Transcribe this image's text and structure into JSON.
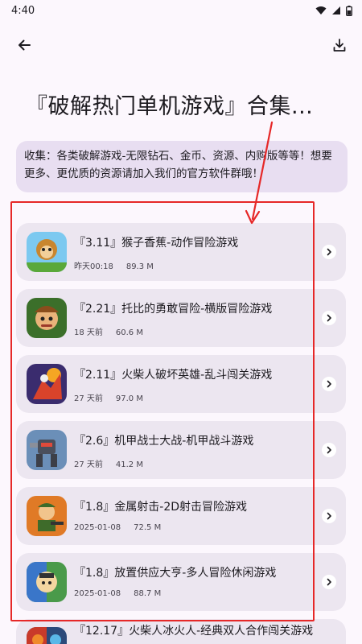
{
  "status": {
    "time": "4:40",
    "icons": [
      "wifi-icon",
      "signal-icon",
      "battery-icon"
    ]
  },
  "toolbar": {
    "back_icon": "arrow-left-icon",
    "download_icon": "download-icon"
  },
  "page": {
    "title": "『破解热门单机游戏』合集...",
    "description": "收集：各类破解游戏-无限钻石、金币、资源、内购版等等！想要更多、更优质的资源请加入我们的官方软件群哦！"
  },
  "items": [
    {
      "title": "『3.11』猴子香蕉-动作冒险游戏",
      "time": "昨天00:18",
      "size": "89.3 M"
    },
    {
      "title": "『2.21』托比的勇敢冒险-横版冒险游戏",
      "time": "18 天前",
      "size": "60.6 M"
    },
    {
      "title": "『2.11』火柴人破坏英雄-乱斗闯关游戏",
      "time": "27 天前",
      "size": "97.0 M"
    },
    {
      "title": "『2.6』机甲战士大战-机甲战斗游戏",
      "time": "27 天前",
      "size": "41.2 M"
    },
    {
      "title": "『1.8』金属射击-2D射击冒险游戏",
      "time": "2025-01-08",
      "size": "72.5 M"
    },
    {
      "title": "『1.8』放置供应大亨-多人冒险休闲游戏",
      "time": "2025-01-08",
      "size": "88.7 M"
    },
    {
      "title": "『12.17』火柴人冰火人-经典双人合作闯关游戏"
    }
  ]
}
